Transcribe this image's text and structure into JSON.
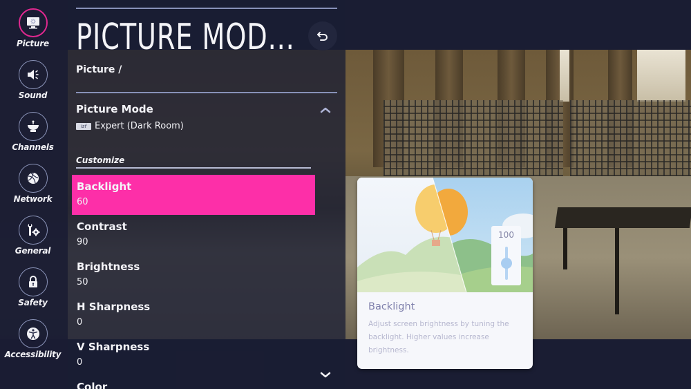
{
  "sidebar": {
    "items": [
      {
        "label": "Picture",
        "icon": "picture-icon",
        "active": true
      },
      {
        "label": "Sound",
        "icon": "speaker-icon",
        "active": false
      },
      {
        "label": "Channels",
        "icon": "satellite-dish-icon",
        "active": false
      },
      {
        "label": "Network",
        "icon": "globe-icon",
        "active": false
      },
      {
        "label": "General",
        "icon": "wrench-gear-icon",
        "active": false
      },
      {
        "label": "Safety",
        "icon": "lock-icon",
        "active": false
      },
      {
        "label": "Accessibility",
        "icon": "accessibility-icon",
        "active": false
      }
    ]
  },
  "header": {
    "title": "PICTURE MOD...",
    "breadcrumb": "Picture /",
    "back_icon": "back-arrow-icon"
  },
  "picture_mode": {
    "label": "Picture Mode",
    "badge": "isf",
    "value": "Expert (Dark Room)",
    "expand_icon": "chevron-up-icon"
  },
  "customize": {
    "label": "Customize",
    "settings": [
      {
        "name": "Backlight",
        "value": "60",
        "selected": true
      },
      {
        "name": "Contrast",
        "value": "90",
        "selected": false
      },
      {
        "name": "Brightness",
        "value": "50",
        "selected": false
      },
      {
        "name": "H Sharpness",
        "value": "0",
        "selected": false
      },
      {
        "name": "V Sharpness",
        "value": "0",
        "selected": false
      },
      {
        "name": "Color",
        "value": "",
        "selected": false
      }
    ],
    "scroll_icon": "chevron-down-icon"
  },
  "help_card": {
    "title": "Backlight",
    "description": "Adjust screen brightness by tuning the backlight. Higher values increase brightness.",
    "illustration_slider_value": "100",
    "illustration_slider_level": 0.75
  },
  "colors": {
    "accent": "#fd2fa8",
    "active_ring": "#e0288f",
    "panel_bg": "#1a1d33",
    "rule": "#8791b8"
  }
}
